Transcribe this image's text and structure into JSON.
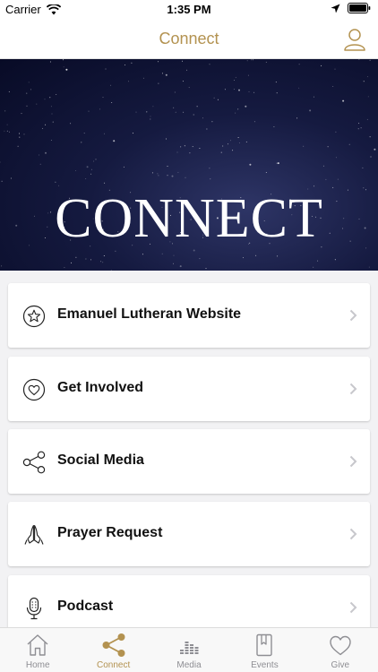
{
  "status": {
    "carrier": "Carrier",
    "time": "1:35 PM"
  },
  "nav": {
    "title": "Connect"
  },
  "hero": {
    "title": "CONNECT"
  },
  "items": [
    {
      "label": "Emanuel Lutheran Website",
      "icon": "star-icon"
    },
    {
      "label": "Get Involved",
      "icon": "heart-icon"
    },
    {
      "label": "Social Media",
      "icon": "share-icon"
    },
    {
      "label": "Prayer Request",
      "icon": "praying-hands-icon"
    },
    {
      "label": "Podcast",
      "icon": "microphone-icon"
    }
  ],
  "tabs": [
    {
      "label": "Home",
      "icon": "home-icon"
    },
    {
      "label": "Connect",
      "icon": "share-icon",
      "active": true
    },
    {
      "label": "Media",
      "icon": "equalizer-icon"
    },
    {
      "label": "Events",
      "icon": "bookmark-book-icon"
    },
    {
      "label": "Give",
      "icon": "heart-icon"
    }
  ],
  "colors": {
    "accent": "#b39250",
    "hero_bg": "#0b0f2e",
    "tab_inactive": "#8e8e93"
  }
}
